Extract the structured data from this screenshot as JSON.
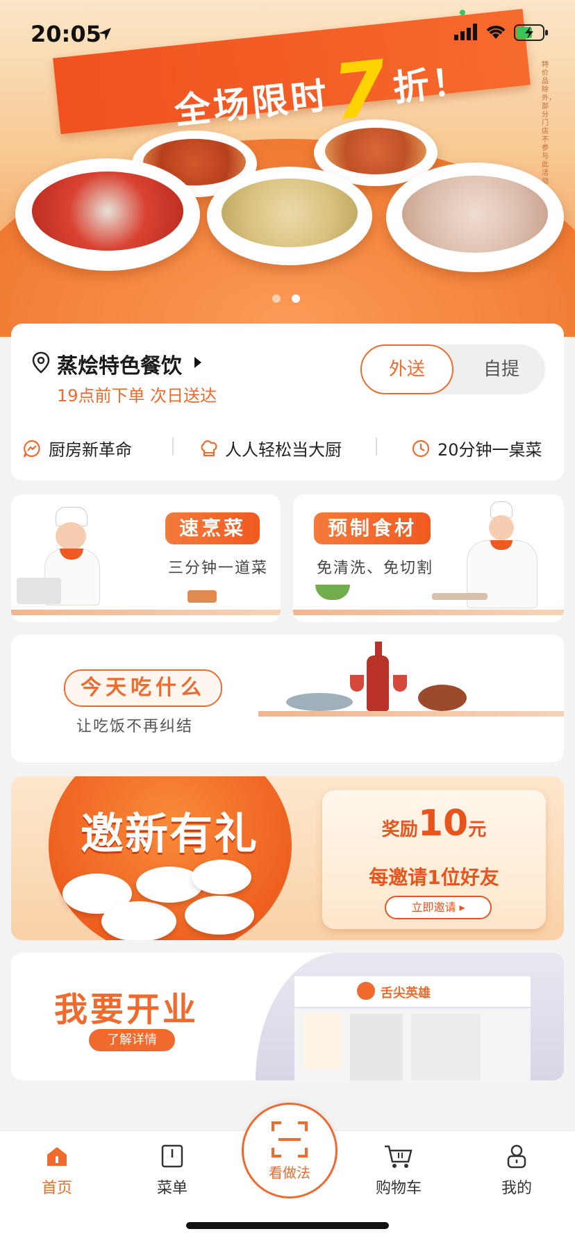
{
  "status_bar": {
    "time": "20:05"
  },
  "hero_banner": {
    "headline_prefix": "全场限时",
    "headline_number": "7",
    "headline_suffix": "折！",
    "side_note": "特价品除外，部分门店不参与此活动",
    "carousel": {
      "total": 2,
      "active": 2
    },
    "colors": {
      "ribbon": "#f0511f",
      "number": "#ffd300"
    }
  },
  "location_card": {
    "store_name": "蒸烩特色餐饮",
    "delivery_note": "19点前下单 次日送达",
    "mode_toggle": {
      "options": [
        "外送",
        "自提"
      ],
      "selected": "外送"
    },
    "features": [
      {
        "icon": "chat-bolt-icon",
        "label": "厨房新革命"
      },
      {
        "icon": "chef-hat-icon",
        "label": "人人轻松当大厨"
      },
      {
        "icon": "clock-icon",
        "label": "20分钟一桌菜"
      }
    ]
  },
  "function_tiles": [
    {
      "title": "速烹菜",
      "subtitle": "三分钟一道菜"
    },
    {
      "title": "预制食材",
      "subtitle": "免清洗、免切割"
    }
  ],
  "today_banner": {
    "title": "今天吃什么",
    "subtitle": "让吃饭不再纠结"
  },
  "invite_banner": {
    "title": "邀新有礼",
    "reward_label": "奖励",
    "reward_amount": "10",
    "reward_unit": "元",
    "reward_desc": "每邀请1位好友",
    "cta": "立即邀请 ▸"
  },
  "open_store_banner": {
    "title": "我要开业",
    "cta": "了解详情",
    "shop_sign": "舌尖英雄"
  },
  "tab_bar": {
    "items": [
      {
        "label": "首页",
        "icon": "home-icon",
        "active": true
      },
      {
        "label": "菜单",
        "icon": "menu-icon",
        "active": false
      },
      {
        "label": "看做法",
        "icon": "scan-icon",
        "active": false
      },
      {
        "label": "购物车",
        "icon": "cart-icon",
        "active": false
      },
      {
        "label": "我的",
        "icon": "user-icon",
        "active": false
      }
    ]
  },
  "theme": {
    "accent": "#ef6a2c"
  }
}
